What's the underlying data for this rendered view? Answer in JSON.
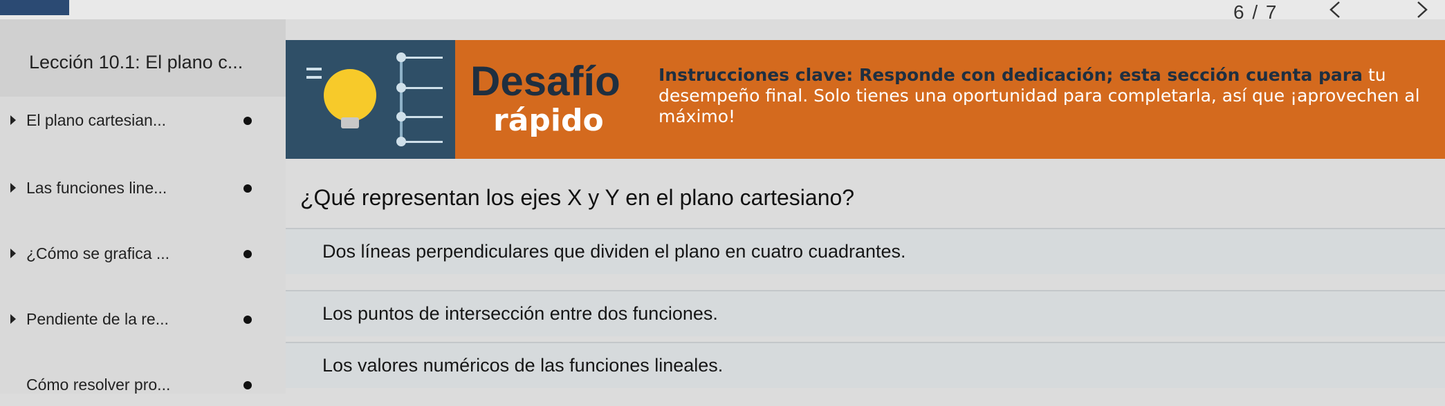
{
  "header": {
    "page_indicator": "6 / 7",
    "prev_label": "<",
    "next_label": ">"
  },
  "sidebar": {
    "lesson_title": "Lección 10.1: El plano c...",
    "items": [
      {
        "label": "El plano cartesian..."
      },
      {
        "label": "Las funciones line..."
      },
      {
        "label": "¿Cómo se grafica ..."
      },
      {
        "label": "Pendiente de la re..."
      },
      {
        "label": "Cómo resolver pro..."
      }
    ]
  },
  "banner": {
    "title": "Desafío",
    "subtitle": "rápido",
    "instructions_strong": "Instrucciones clave: Responde con dedicación; esta sección cuenta para",
    "instructions_rest": "tu desempeño final. Solo tienes una oportunidad para completarla, así que ¡aprovechen al máximo!",
    "color": "#d46a1e"
  },
  "question": {
    "text": "¿Qué representan los ejes X y Y en el plano cartesiano?",
    "options": [
      {
        "text": "Dos líneas perpendiculares que dividen el plano en cuatro cuadrantes."
      },
      {
        "text": "Los puntos de intersección entre dos funciones."
      },
      {
        "text": "Los valores numéricos de las funciones lineales."
      }
    ]
  },
  "icons": [
    "lightbulb-icon",
    "chevron-left-icon",
    "chevron-right-icon",
    "caret-right-icon",
    "progress-dot-icon"
  ]
}
